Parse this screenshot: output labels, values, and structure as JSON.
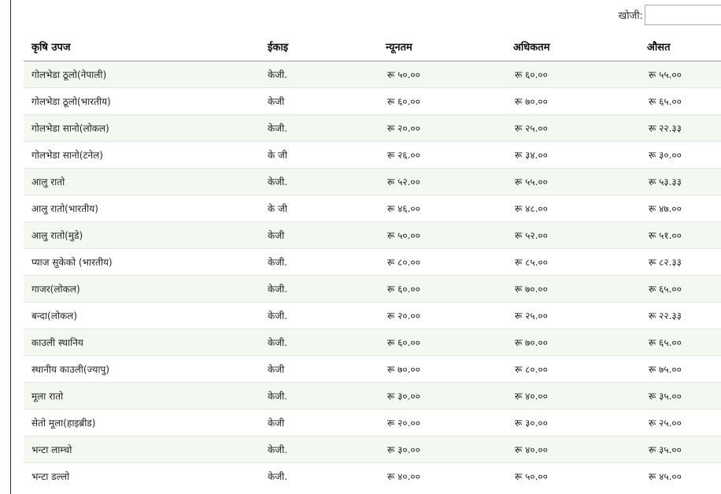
{
  "search": {
    "label": "खोजी:",
    "value": ""
  },
  "table": {
    "headers": [
      "कृषि उपज",
      "ईकाइ",
      "न्यूनतम",
      "अधिकतम",
      "औसत"
    ],
    "rows": [
      [
        "गोलभेडा ठूलो(नेपाली)",
        "केजी.",
        "रू ५०.००",
        "रू ६०.००",
        "रू ५५.००"
      ],
      [
        "गोलभेडा ठूलो(भारतीय)",
        "केजी",
        "रू ६०.००",
        "रू ७०.००",
        "रू ६५.००"
      ],
      [
        "गोलभेडा सानो(लोकल)",
        "केजी.",
        "रू २०.००",
        "रू २५.००",
        "रू २२.३३"
      ],
      [
        "गोलभेडा सानो(टनेल)",
        "के जी",
        "रू २६.००",
        "रू ३४.००",
        "रू ३०.००"
      ],
      [
        "आलु रातो",
        "केजी.",
        "रू ५२.००",
        "रू ५५.००",
        "रू ५३.३३"
      ],
      [
        "आलु रातो(भारतीय)",
        "के जी",
        "रू ४६.००",
        "रू ४८.००",
        "रू ४७.००"
      ],
      [
        "आलु रातो(मुडे)",
        "केजी",
        "रू ५०.००",
        "रू ५२.००",
        "रू ५१.००"
      ],
      [
        "प्याज सुकेको (भारतीय)",
        "केजी.",
        "रू ८०.००",
        "रू ८५.००",
        "रू ८२.३३"
      ],
      [
        "गाजर(लोकल)",
        "केजी.",
        "रू ६०.००",
        "रू ७०.००",
        "रू ६५.००"
      ],
      [
        "बन्दा(लोकल)",
        "केजी.",
        "रू २०.००",
        "रू २५.००",
        "रू २२.३३"
      ],
      [
        "काउली स्थानिय",
        "केजी.",
        "रू ६०.००",
        "रू ७०.००",
        "रू ६५.००"
      ],
      [
        "स्थानीय काउली(ज्यापु)",
        "केजी",
        "रू ७०.००",
        "रू ८०.००",
        "रू ७५.००"
      ],
      [
        "मूला रातो",
        "केजी.",
        "रू ३०.००",
        "रू ४०.००",
        "रू ३५.००"
      ],
      [
        "सेतो मूला(हाइब्रीड)",
        "केजी",
        "रू २०.००",
        "रू ३०.००",
        "रू २५.००"
      ],
      [
        "भन्टा लाम्चो",
        "केजी.",
        "रू ३०.००",
        "रू ४०.००",
        "रू ३५.००"
      ],
      [
        "भन्टा डल्लो",
        "केजी.",
        "रू ४०.००",
        "रू ५०.००",
        "रू ४५.००"
      ]
    ]
  }
}
